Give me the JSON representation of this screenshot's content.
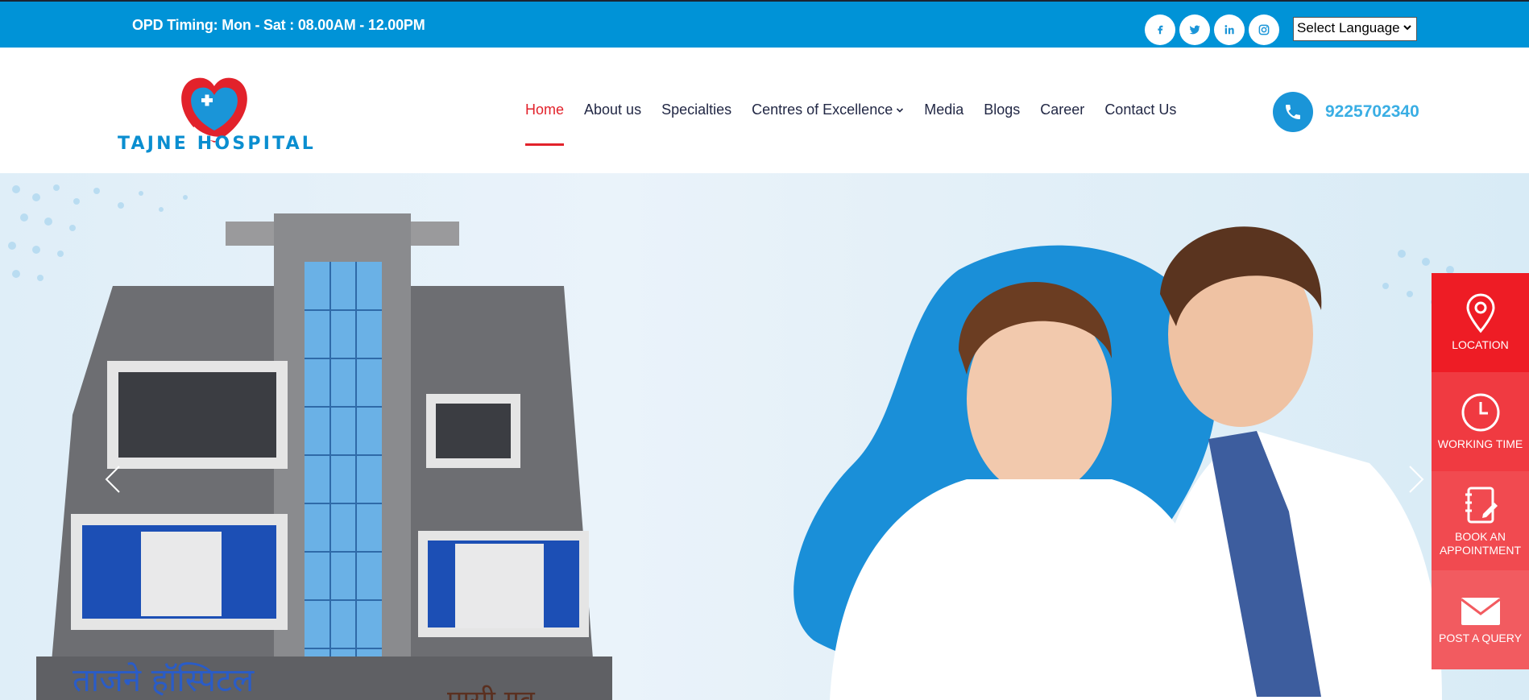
{
  "topbar": {
    "opd_timing": "OPD Timing: Mon - Sat : 08.00AM - 12.00PM",
    "socials": [
      {
        "name": "facebook",
        "icon": "facebook-icon"
      },
      {
        "name": "twitter",
        "icon": "twitter-icon"
      },
      {
        "name": "linkedin",
        "icon": "linkedin-icon"
      },
      {
        "name": "instagram",
        "icon": "instagram-icon"
      }
    ],
    "language_select": "Select Language"
  },
  "header": {
    "logo_text": "TAJNE HOSPITAL",
    "nav": [
      {
        "label": "Home",
        "active": true
      },
      {
        "label": "About us"
      },
      {
        "label": "Specialties"
      },
      {
        "label": "Centres of Excellence",
        "dropdown": true
      },
      {
        "label": "Media"
      },
      {
        "label": "Blogs"
      },
      {
        "label": "Career"
      },
      {
        "label": "Contact Us"
      }
    ],
    "phone": "9225702340"
  },
  "hero": {
    "building_sign_left": "ताजने हॉस्पिटल",
    "building_sign_right": "पासी गव"
  },
  "side_panel": [
    {
      "label": "LOCATION",
      "icon": "location-pin-icon"
    },
    {
      "label": "WORKING TIME",
      "icon": "clock-icon"
    },
    {
      "label": "BOOK AN APPOINTMENT",
      "icon": "notebook-icon"
    },
    {
      "label": "POST A QUERY",
      "icon": "envelope-icon"
    }
  ],
  "colors": {
    "topbar_bg": "#0093d7",
    "accent_red": "#ee1c25",
    "brand_blue": "#0a8ed0",
    "nav_text": "#222845"
  }
}
